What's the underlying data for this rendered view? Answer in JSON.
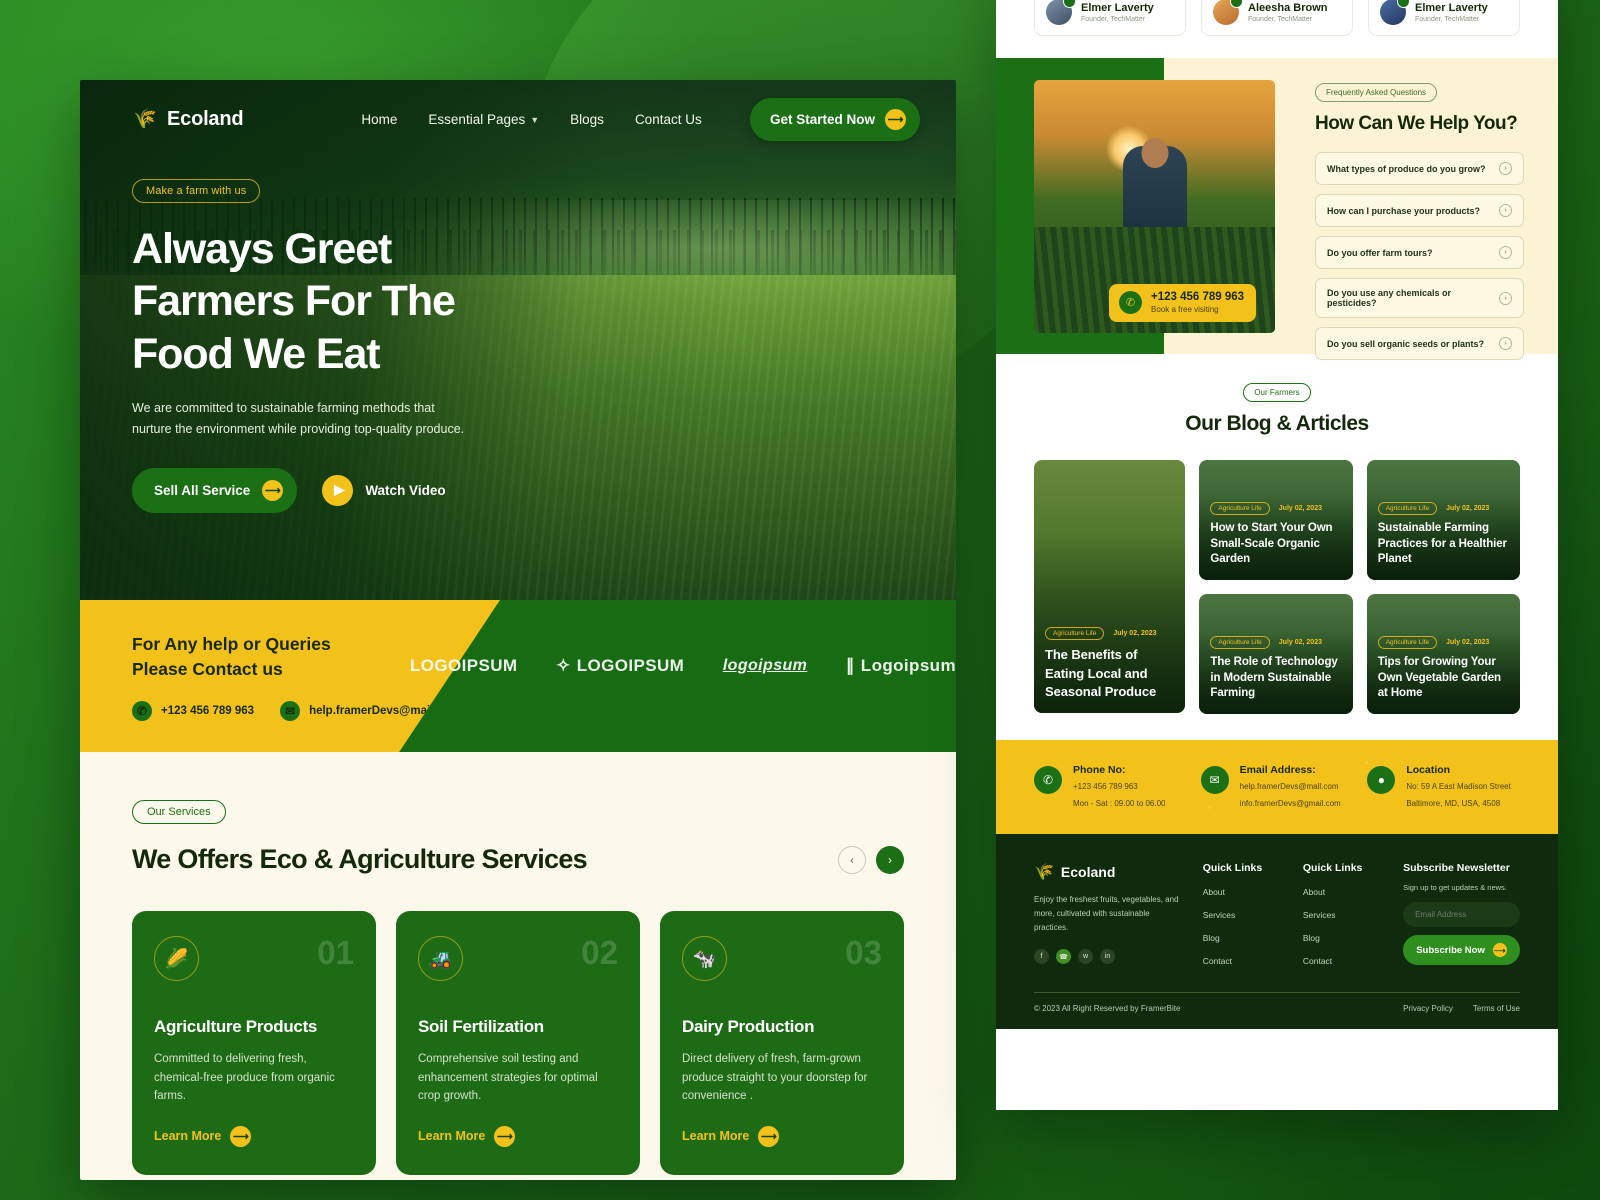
{
  "brand": {
    "name": "Ecoland",
    "logo_icon": "wheat-icon"
  },
  "nav": {
    "links": [
      {
        "label": "Home",
        "icon": ""
      },
      {
        "label": "Essential Pages",
        "icon": "chevron-down-icon"
      },
      {
        "label": "Blogs",
        "icon": ""
      },
      {
        "label": "Contact Us",
        "icon": ""
      }
    ],
    "cta": "Get Started Now"
  },
  "hero": {
    "badge": "Make a farm with us",
    "title_lines": [
      "Always Greet",
      "Farmers For The",
      "Food We Eat"
    ],
    "subtitle": "We are committed to sustainable farming methods that nurture the environment while providing top-quality produce.",
    "primary_button": "Sell All Service",
    "video_button": "Watch Video"
  },
  "contact_strip": {
    "title_line1": "For Any help or Queries",
    "title_line2": "Please Contact us",
    "phone": "+123 456 789 963",
    "email": "help.framerDevs@mail.com",
    "logos": [
      "LOGOIPSUM",
      "LOGOIPSUM",
      "logoipsum",
      "Logoipsum"
    ]
  },
  "services": {
    "pill": "Our Services",
    "heading": "We Offers Eco & Agriculture Services",
    "prev_icon": "chevron-left-icon",
    "next_icon": "chevron-right-icon",
    "cards": [
      {
        "number": "01",
        "icon": "crops-sun-icon",
        "title": "Agriculture Products",
        "text": "Committed to delivering fresh, chemical-free produce from organic farms.",
        "link": "Learn More"
      },
      {
        "number": "02",
        "icon": "tractor-icon",
        "title": "Soil Fertilization",
        "text": "Comprehensive soil testing and enhancement strategies for optimal crop growth.",
        "link": "Learn More"
      },
      {
        "number": "03",
        "icon": "dairy-icon",
        "title": "Dairy Production",
        "text": "Direct delivery of fresh, farm-grown produce straight to your doorstep for convenience .",
        "link": "Learn More"
      }
    ]
  },
  "testimonials": [
    {
      "name": "Elmer Laverty",
      "role": "Founder, TechMatter"
    },
    {
      "name": "Aleesha Brown",
      "role": "Founder, TechMatter"
    },
    {
      "name": "Elmer Laverty",
      "role": "Founder, TechMatter"
    }
  ],
  "faq": {
    "pill": "Frequently Asked Questions",
    "heading": "How Can We Help You?",
    "phone_badge": {
      "number": "+123 456 789 963",
      "subtitle": "Book a free visiting"
    },
    "items": [
      "What types of produce do you grow?",
      "How can I purchase your products?",
      "Do you offer farm tours?",
      "Do you use any chemicals or pesticides?",
      "Do you sell organic seeds or plants?"
    ]
  },
  "blog": {
    "pill": "Our Farmers",
    "heading": "Our Blog & Articles",
    "featured": {
      "tag": "Agriculture Life",
      "date": "July 02, 2023",
      "title": "The Benefits of Eating Local and Seasonal Produce"
    },
    "posts": [
      {
        "tag": "Agriculture Life",
        "date": "July 02, 2023",
        "title": "How to Start Your Own Small-Scale Organic Garden"
      },
      {
        "tag": "Agriculture Life",
        "date": "July 02, 2023",
        "title": "Sustainable Farming Practices for a Healthier Planet"
      },
      {
        "tag": "Agriculture Life",
        "date": "July 02, 2023",
        "title": "The Role of Technology in Modern Sustainable Farming"
      },
      {
        "tag": "Agriculture Life",
        "date": "July 02, 2023",
        "title": "Tips for Growing Your Own Vegetable Garden at Home"
      }
    ]
  },
  "contact_bar": [
    {
      "icon": "phone-icon",
      "label": "Phone No:",
      "line1": "+123 456 789 963",
      "line2": "Mon - Sat : 09.00 to 06.00"
    },
    {
      "icon": "mail-icon",
      "label": "Email Address:",
      "line1": "help.framerDevs@mall.com",
      "line2": "info.framerDevs@gmail.com"
    },
    {
      "icon": "location-icon",
      "label": "Location",
      "line1": "No: 59 A East Madison Street",
      "line2": "Baltimore, MD, USA, 4508"
    }
  ],
  "footer": {
    "brand": "Ecoland",
    "description": "Enjoy the freshest fruits, vegetables, and more, cultivated with sustainable practices.",
    "socials": [
      "facebook-icon",
      "whatsapp-icon",
      "twitter-icon",
      "linkedin-icon"
    ],
    "col1": {
      "heading": "Quick Links",
      "links": [
        "About",
        "Services",
        "Blog",
        "Contact"
      ]
    },
    "col2": {
      "heading": "Quick Links",
      "links": [
        "About",
        "Services",
        "Blog",
        "Contact"
      ]
    },
    "newsletter": {
      "heading": "Subscribe Newsletter",
      "description": "Sign up to get updates & news.",
      "placeholder": "Email Address",
      "button": "Subscribe Now"
    },
    "copyright": "© 2023 All Right Reserved by FramerBite",
    "legal": [
      "Privacy Policy",
      "Terms of Use"
    ]
  },
  "colors": {
    "green": "#1b6f15",
    "dark_green": "#0f2a0c",
    "yellow": "#f2c21a",
    "cream": "#fdf8ec"
  }
}
